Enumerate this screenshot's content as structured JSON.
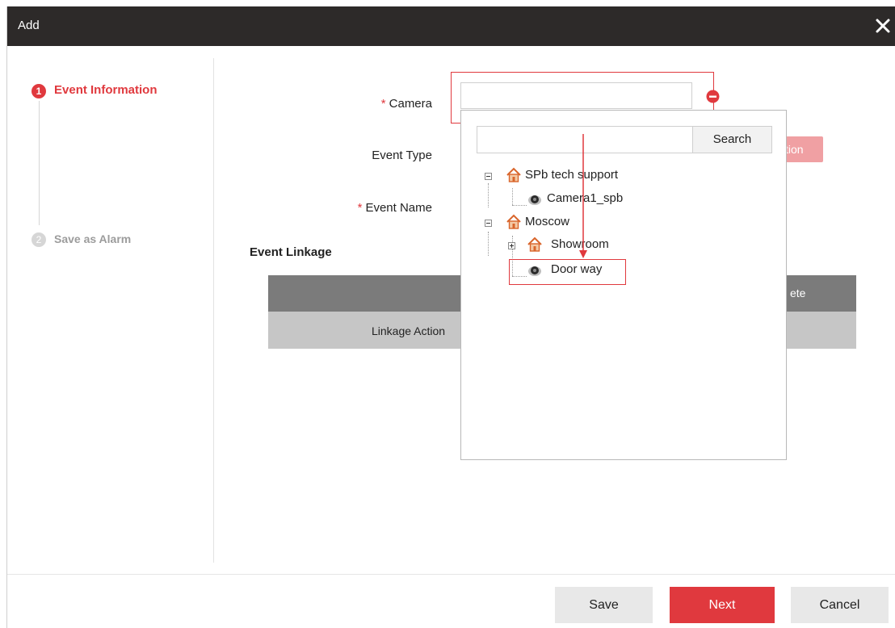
{
  "dialog": {
    "title": "Add"
  },
  "steps": [
    {
      "number": "1",
      "label": "Event Information",
      "active": true
    },
    {
      "number": "2",
      "label": "Save as Alarm",
      "active": false
    }
  ],
  "form": {
    "required_mark": "*",
    "camera_label": "Camera",
    "camera_value": "",
    "event_type_label": "Event Type",
    "event_type_button_partial": "tion",
    "event_name_label": "Event Name"
  },
  "linkage": {
    "title": "Event Linkage",
    "header_partial": "ete",
    "row_partial": "Linkage Action"
  },
  "dropdown": {
    "search_value": "",
    "search_button": "Search",
    "tree": [
      {
        "label": "SPb tech support",
        "type": "area",
        "expanded": true
      },
      {
        "label": "Camera1_spb",
        "type": "camera"
      },
      {
        "label": "Moscow",
        "type": "area",
        "expanded": true
      },
      {
        "label": "Showroom",
        "type": "area",
        "expanded": false
      },
      {
        "label": "Door way",
        "type": "camera",
        "highlighted": true
      }
    ]
  },
  "footer": {
    "save": "Save",
    "next": "Next",
    "cancel": "Cancel"
  },
  "colors": {
    "accent": "#e0393e",
    "titlebar": "#2d2a29",
    "house_icon": "#d9652b"
  }
}
